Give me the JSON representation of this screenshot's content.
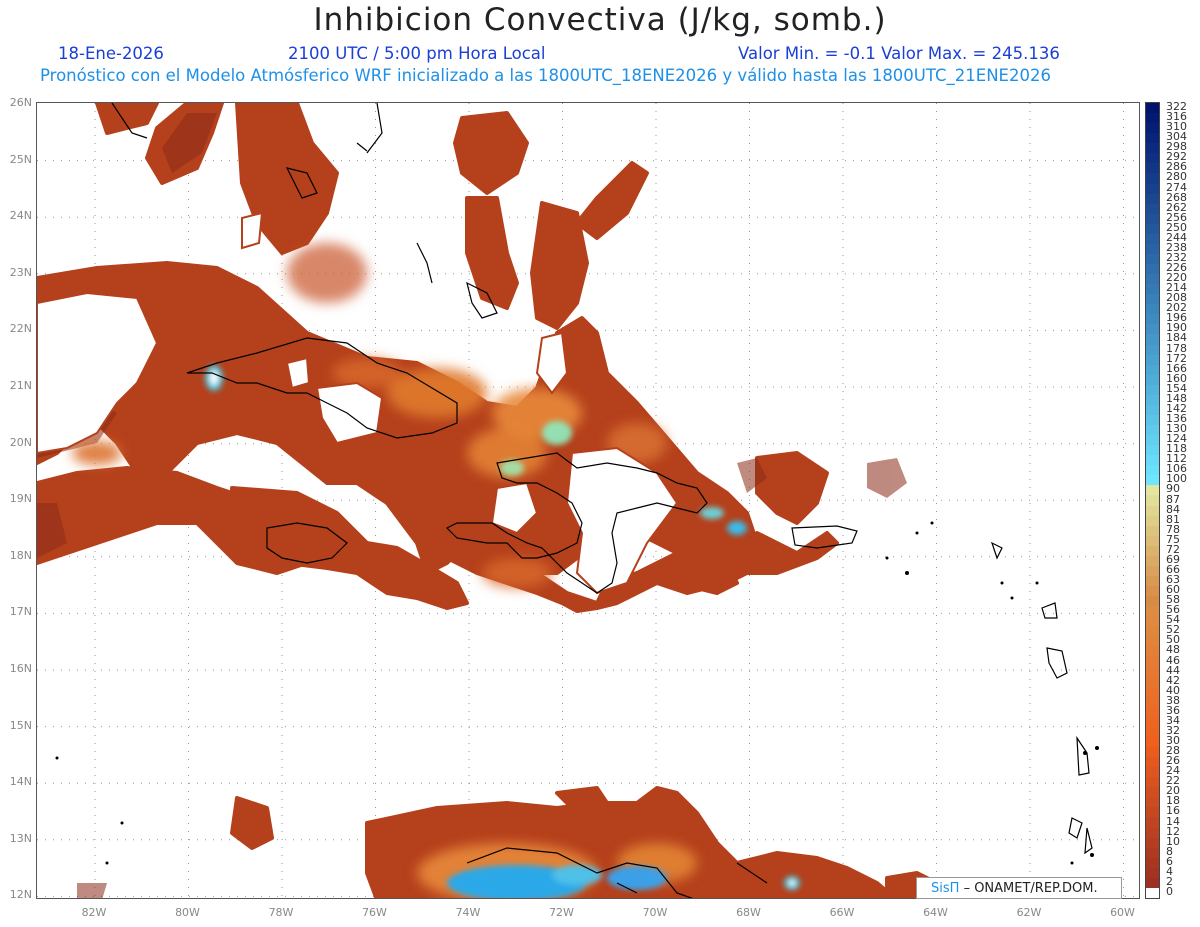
{
  "header": {
    "title": "Inhibicion Convectiva (J/kg, somb.)",
    "date": "18-Ene-2026",
    "time": "2100 UTC / 5:00 pm Hora Local",
    "minmax": "Valor Min. = -0.1  Valor Max. = 245.136",
    "model_info": "Pronóstico con el Modelo Atmósferico WRF inicializado a las 1800UTC_18ENE2026 y válido hasta las  1800UTC_21ENE2026"
  },
  "map": {
    "lat_labels": [
      "26N",
      "25N",
      "24N",
      "23N",
      "22N",
      "21N",
      "20N",
      "19N",
      "18N",
      "17N",
      "16N",
      "15N",
      "14N",
      "13N",
      "12N"
    ],
    "lon_labels": [
      "82W",
      "80W",
      "78W",
      "76W",
      "74W",
      "72W",
      "70W",
      "68W",
      "66W",
      "64W",
      "62W",
      "60W"
    ],
    "field_color": "#b5401c",
    "coast_color": "#000000"
  },
  "colorbar": {
    "labels": [
      "322",
      "316",
      "310",
      "304",
      "298",
      "292",
      "286",
      "280",
      "274",
      "268",
      "262",
      "256",
      "250",
      "244",
      "238",
      "232",
      "226",
      "220",
      "214",
      "208",
      "202",
      "196",
      "190",
      "184",
      "178",
      "172",
      "166",
      "160",
      "154",
      "148",
      "142",
      "136",
      "130",
      "124",
      "118",
      "112",
      "106",
      "100",
      "90",
      "87",
      "84",
      "81",
      "78",
      "75",
      "72",
      "69",
      "66",
      "63",
      "60",
      "58",
      "56",
      "54",
      "52",
      "50",
      "48",
      "46",
      "44",
      "42",
      "40",
      "38",
      "36",
      "34",
      "32",
      "30",
      "28",
      "26",
      "24",
      "22",
      "20",
      "18",
      "16",
      "14",
      "12",
      "10",
      "8",
      "6",
      "4",
      "2",
      "0"
    ]
  },
  "credit": {
    "logo": "SisΠ",
    "text": "– ONAMET/REP.DOM."
  }
}
